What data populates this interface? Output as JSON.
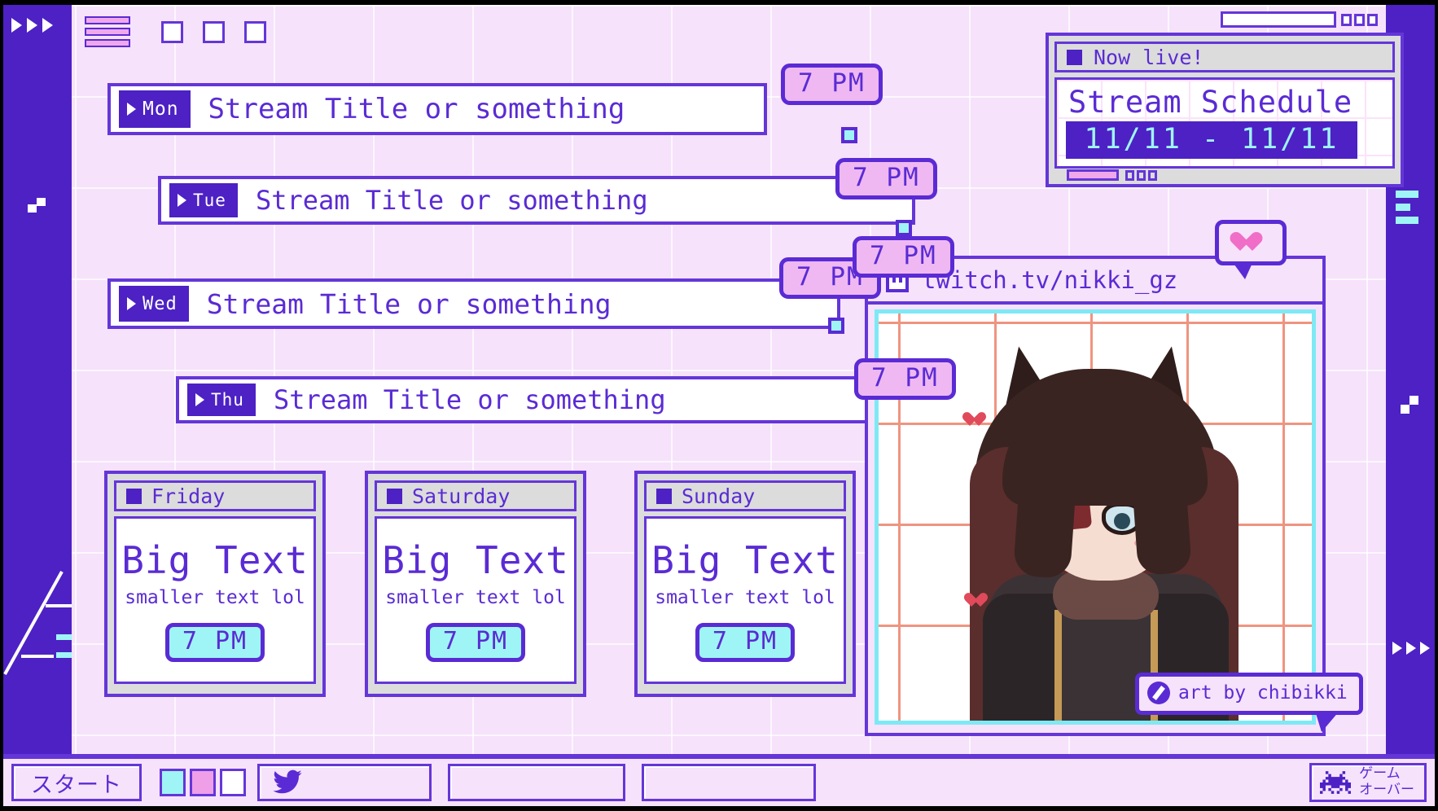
{
  "app": {
    "title": "Stream Schedule",
    "accent_purple": "#5a2bd4",
    "accent_deep": "#4d21c4",
    "accent_pink": "#efb8f2",
    "accent_cyan": "#9ff5f5",
    "bg": "#f6e2fb"
  },
  "toolbar": {
    "menu_icon": "hamburger-icon",
    "buttons": [
      "",
      "",
      ""
    ]
  },
  "schedule_window": {
    "titlebar": "Now live!",
    "heading": "Stream Schedule",
    "date_range": "11/11 - 11/11"
  },
  "weekdays": [
    {
      "day": "Mon",
      "title": "Stream Title or something",
      "time": "7 PM"
    },
    {
      "day": "Tue",
      "title": "Stream Title or something",
      "time": "7 PM"
    },
    {
      "day": "Wed",
      "title": "Stream Title or something",
      "time": "7 PM"
    },
    {
      "day": "Thu",
      "title": "Stream Title or something",
      "time": "7 PM"
    }
  ],
  "weekend_cards": [
    {
      "day": "Friday",
      "big": "Big Text",
      "small": "smaller text lol",
      "time": "7 PM"
    },
    {
      "day": "Saturday",
      "big": "Big Text",
      "small": "smaller text lol",
      "time": "7 PM"
    },
    {
      "day": "Sunday",
      "big": "Big Text",
      "small": "smaller text lol",
      "time": "7 PM"
    }
  ],
  "twitch": {
    "url": "twitch.tv/nikki_gz",
    "icon": "twitch-icon",
    "time_badge": "7 PM",
    "art_credit": "art by chibikki",
    "credit_icon": "pen-icon"
  },
  "taskbar": {
    "start": "スタート",
    "swatches": [
      "#9ff5f5",
      "#ef9fe8",
      "#ffffff"
    ],
    "twitter_icon": "twitter-bird-icon",
    "slot_2": "",
    "slot_3": "",
    "gameover_line1": "ゲーム",
    "gameover_line2": "オーバー",
    "gameover_icon": "space-invader-icon"
  }
}
